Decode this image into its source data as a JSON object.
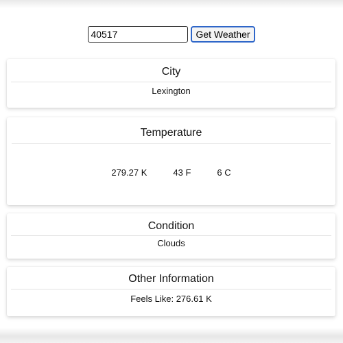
{
  "search": {
    "zip_value": "40517",
    "button_label": "Get Weather"
  },
  "city": {
    "title": "City",
    "value": "Lexington"
  },
  "temperature": {
    "title": "Temperature",
    "kelvin": "279.27 K",
    "fahrenheit": "43 F",
    "celsius": "6 C"
  },
  "condition": {
    "title": "Condition",
    "value": "Clouds"
  },
  "other": {
    "title": "Other Information",
    "feels_like": "Feels Like: 276.61 K"
  },
  "colors": {
    "button_border": "#2e66c9",
    "card_background": "#ffffff",
    "divider": "#e3e3e3"
  }
}
